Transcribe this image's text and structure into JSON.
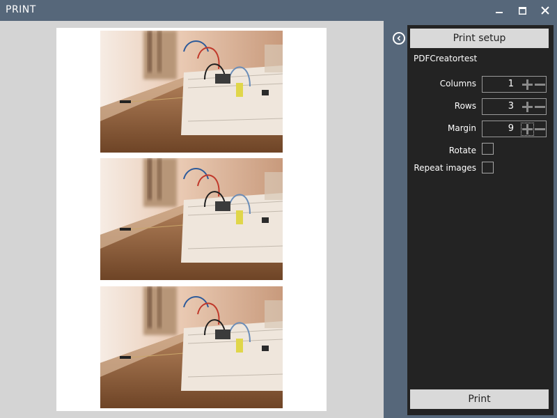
{
  "window": {
    "title": "PRINT",
    "minimize_icon": "minimize-icon",
    "maximize_icon": "maximize-icon",
    "close_icon": "close-icon"
  },
  "preview": {
    "pages": [
      {
        "image": "breadboard-photo"
      },
      {
        "image": "breadboard-photo"
      },
      {
        "image": "breadboard-photo"
      }
    ]
  },
  "panel": {
    "collapse_icon": "chevron-left-circle-icon",
    "print_setup_label": "Print setup",
    "printer_name": "PDFCreatortest",
    "columns": {
      "label": "Columns",
      "value": "1"
    },
    "rows": {
      "label": "Rows",
      "value": "3"
    },
    "margin": {
      "label": "Margin",
      "value": "9"
    },
    "rotate": {
      "label": "Rotate",
      "checked": false
    },
    "repeat_images": {
      "label": "Repeat images",
      "checked": false
    },
    "print_label": "Print"
  },
  "colors": {
    "titlebar": "#56677a",
    "panel": "#232323",
    "button": "#d9d9d9",
    "preview_bg": "#d4d4d4"
  }
}
